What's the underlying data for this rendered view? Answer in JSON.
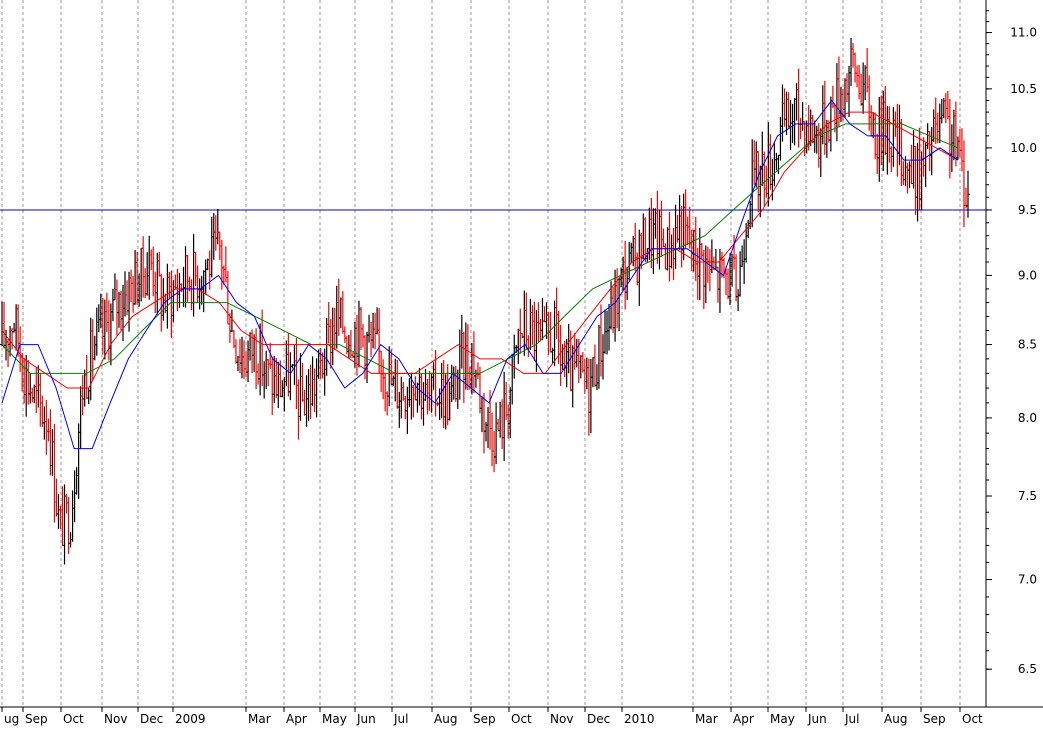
{
  "chart_data": {
    "type": "line",
    "subtype": "ohlc-price-chart-log-scale",
    "title": "",
    "xlabel": "",
    "ylabel": "",
    "y_scale": "log",
    "ylim": [
      6.3,
      11.3
    ],
    "y_ticks": [
      "6.5",
      "7.0",
      "7.5",
      "8.0",
      "8.5",
      "9.0",
      "9.5",
      "10.0",
      "10.5",
      "11.0"
    ],
    "x_ticks": [
      "ug",
      "Sep",
      "Oct",
      "Nov",
      "Dec",
      "2009",
      "Mar",
      "Apr",
      "May",
      "Jun",
      "Jul",
      "Aug",
      "Sep",
      "Oct",
      "Nov",
      "Dec",
      "2010",
      "Mar",
      "Apr",
      "May",
      "Jun",
      "Jul",
      "Aug",
      "Sep",
      "Oct"
    ],
    "grid": {
      "vertical": true,
      "horizontal": false,
      "style": "dotted"
    },
    "horizontal_line": {
      "value": 9.5,
      "color": "#0000cc"
    },
    "colors": {
      "up_bar": "#000000",
      "down_bar": "#ff0000",
      "ma_short": "#0000ff",
      "ma_mid": "#ff0000",
      "ma_long": "#008000"
    },
    "weekly_close": [
      8.5,
      8.7,
      8.3,
      8.1,
      8.0,
      7.3,
      7.4,
      8.2,
      8.5,
      8.6,
      8.8,
      8.9,
      9.0,
      9.1,
      8.8,
      8.9,
      9.0,
      9.0,
      9.1,
      9.2,
      8.6,
      8.4,
      8.5,
      8.3,
      8.2,
      8.3,
      8.1,
      8.2,
      8.4,
      8.7,
      8.6,
      8.6,
      8.5,
      8.4,
      8.2,
      8.2,
      8.3,
      8.1,
      8.2,
      8.1,
      8.4,
      8.4,
      8.0,
      7.9,
      8.1,
      8.6,
      8.6,
      8.5,
      8.6,
      8.3,
      8.3,
      8.2,
      8.5,
      8.7,
      9.0,
      9.1,
      9.3,
      9.3,
      9.2,
      9.4,
      9.2,
      9.1,
      9.0,
      9.0,
      8.9,
      9.7,
      9.8,
      9.9,
      10.2,
      10.3,
      10.2,
      10.1,
      10.3,
      10.5,
      10.7,
      10.5,
      10.1,
      10.2,
      10.0,
      9.8,
      9.8,
      10.1,
      10.2,
      10.0,
      9.6
    ],
    "ma_short": [
      8.1,
      8.5,
      8.5,
      8.2,
      7.8,
      7.8,
      8.1,
      8.4,
      8.6,
      8.8,
      8.9,
      8.9,
      9.0,
      8.8,
      8.7,
      8.4,
      8.3,
      8.5,
      8.4,
      8.2,
      8.3,
      8.5,
      8.4,
      8.2,
      8.1,
      8.3,
      8.2,
      8.1,
      8.4,
      8.5,
      8.3,
      8.3,
      8.5,
      8.7,
      8.8,
      9.0,
      9.2,
      9.2,
      9.2,
      9.1,
      9.0,
      9.4,
      9.8,
      10.1,
      10.2,
      10.2,
      10.4,
      10.2,
      10.1,
      10.1,
      9.9,
      9.9,
      10.0,
      9.9
    ],
    "ma_mid": [
      8.6,
      8.4,
      8.3,
      8.2,
      8.2,
      8.5,
      8.7,
      8.8,
      8.9,
      8.9,
      8.8,
      8.6,
      8.5,
      8.5,
      8.5,
      8.5,
      8.4,
      8.3,
      8.3,
      8.3,
      8.4,
      8.5,
      8.4,
      8.4,
      8.3,
      8.3,
      8.5,
      8.7,
      8.9,
      9.1,
      9.2,
      9.2,
      9.1,
      9.1,
      9.3,
      9.5,
      9.8,
      10.0,
      10.2,
      10.3,
      10.3,
      10.2,
      10.1,
      10.0,
      9.9
    ],
    "ma_long": [
      8.5,
      8.3,
      8.3,
      8.3,
      8.4,
      8.6,
      8.8,
      8.8,
      8.8,
      8.7,
      8.6,
      8.5,
      8.5,
      8.4,
      8.3,
      8.3,
      8.3,
      8.3,
      8.4,
      8.5,
      8.7,
      8.9,
      9.0,
      9.1,
      9.2,
      9.3,
      9.5,
      9.7,
      9.9,
      10.1,
      10.2,
      10.2,
      10.2,
      10.1,
      10.0
    ]
  }
}
